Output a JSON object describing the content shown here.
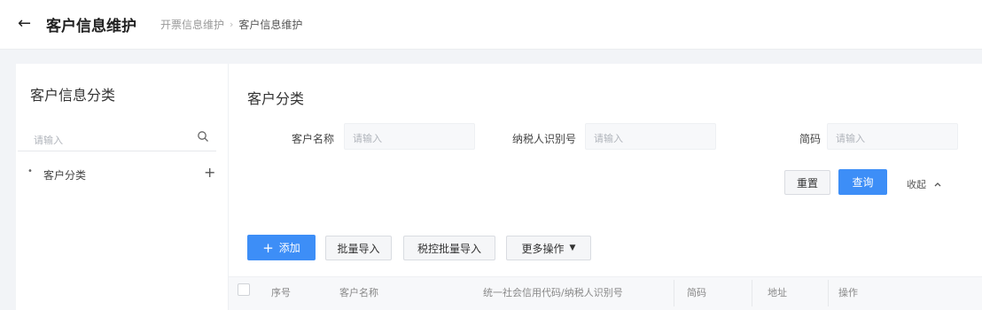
{
  "header": {
    "title": "客户信息维护",
    "breadcrumb": [
      "开票信息维护",
      "客户信息维护"
    ]
  },
  "sidebar": {
    "heading": "客户信息分类",
    "search_placeholder": "请输入",
    "tree": [
      {
        "label": "客户分类"
      }
    ]
  },
  "main": {
    "section_title": "客户分类",
    "filters": [
      {
        "label": "客户名称",
        "placeholder": "请输入"
      },
      {
        "label": "纳税人识别号",
        "placeholder": "请输入"
      },
      {
        "label": "简码",
        "placeholder": "请输入"
      }
    ],
    "reset_label": "重置",
    "query_label": "查询",
    "collapse_label": "收起",
    "toolbar": {
      "add_label": "添加",
      "batch_import_label": "批量导入",
      "tax_batch_import_label": "税控批量导入",
      "more_label": "更多操作"
    },
    "table_headers": [
      "序号",
      "客户名称",
      "统一社会信用代码/纳税人识别号",
      "简码",
      "地址",
      "操作"
    ]
  },
  "colors": {
    "primary": "#3d8ef7",
    "background": "#f2f4f7"
  },
  "icons": {
    "back": "arrow-left-icon",
    "search": "search-icon",
    "add": "plus-icon",
    "more": "caret-down-icon",
    "collapse": "chevron-up-icon"
  }
}
